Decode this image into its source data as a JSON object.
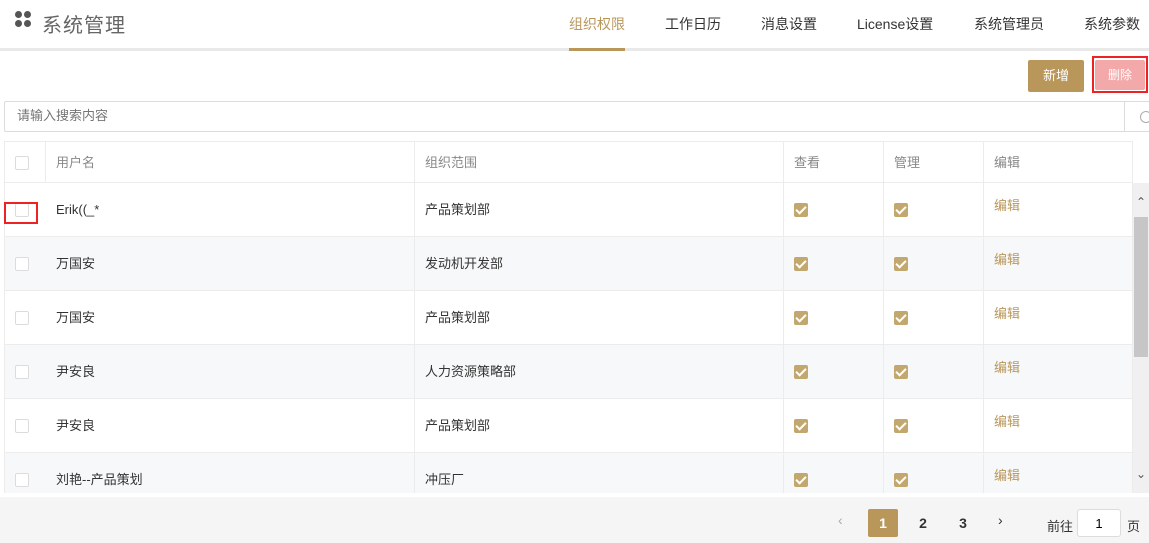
{
  "app": {
    "title": "系统管理",
    "logo_icon": "grid-dots-icon"
  },
  "nav": {
    "tabs": [
      {
        "label": "组织权限",
        "active": true
      },
      {
        "label": "工作日历",
        "active": false
      },
      {
        "label": "消息设置",
        "active": false
      },
      {
        "label": "License设置",
        "active": false
      },
      {
        "label": "系统管理员",
        "active": false
      },
      {
        "label": "系统参数",
        "active": false
      }
    ]
  },
  "toolbar": {
    "add_label": "新增",
    "delete_label": "删除"
  },
  "search": {
    "placeholder": "请输入搜索内容",
    "icon": "search-icon"
  },
  "table": {
    "columns": [
      "用户名",
      "组织范围",
      "查看",
      "管理",
      "编辑"
    ],
    "rows": [
      {
        "username": "Erik((_*",
        "scope": "产品策划部",
        "view": true,
        "manage": true,
        "edit": "编辑"
      },
      {
        "username": "万国安",
        "scope": "发动机开发部",
        "view": true,
        "manage": true,
        "edit": "编辑"
      },
      {
        "username": "万国安",
        "scope": "产品策划部",
        "view": true,
        "manage": true,
        "edit": "编辑"
      },
      {
        "username": "尹安良",
        "scope": "人力资源策略部",
        "view": true,
        "manage": true,
        "edit": "编辑"
      },
      {
        "username": "尹安良",
        "scope": "产品策划部",
        "view": true,
        "manage": true,
        "edit": "编辑"
      },
      {
        "username": "刘艳--产品策划",
        "scope": "冲压厂",
        "view": true,
        "manage": true,
        "edit": "编辑"
      }
    ]
  },
  "pagination": {
    "prev": "‹",
    "next": "›",
    "pages": [
      "1",
      "2",
      "3"
    ],
    "current": "1",
    "goto_label": "前往",
    "goto_value": "1",
    "goto_unit": "页"
  },
  "colors": {
    "accent": "#b9975b",
    "danger_outline": "#ee2222",
    "delete_bg": "#f3a9a9"
  }
}
